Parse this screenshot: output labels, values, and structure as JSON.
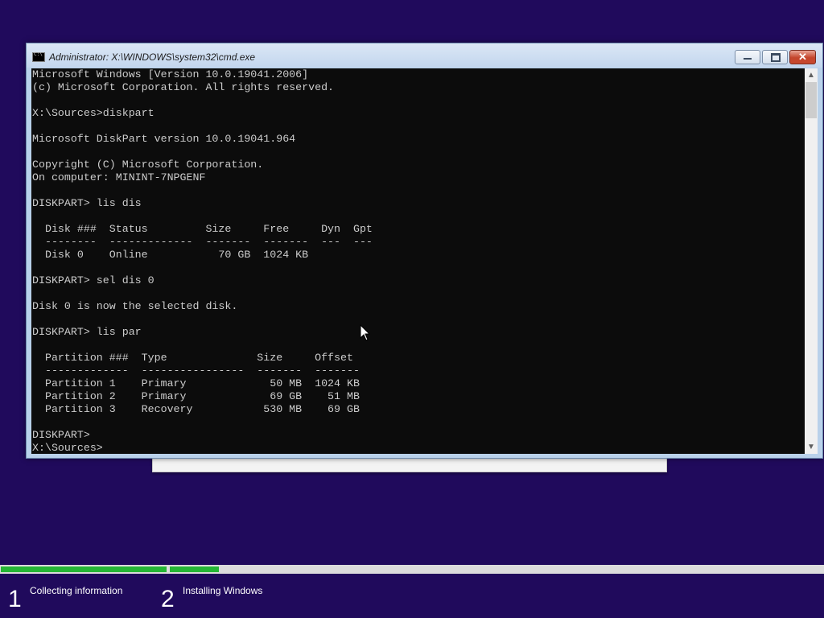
{
  "window": {
    "title": "Administrator: X:\\WINDOWS\\system32\\cmd.exe",
    "close_glyph": "✕"
  },
  "console": {
    "lines": [
      "Microsoft Windows [Version 10.0.19041.2006]",
      "(c) Microsoft Corporation. All rights reserved.",
      "",
      "X:\\Sources>diskpart",
      "",
      "Microsoft DiskPart version 10.0.19041.964",
      "",
      "Copyright (C) Microsoft Corporation.",
      "On computer: MININT-7NPGENF",
      "",
      "DISKPART> lis dis",
      "",
      "  Disk ###  Status         Size     Free     Dyn  Gpt",
      "  --------  -------------  -------  -------  ---  ---",
      "  Disk 0    Online           70 GB  1024 KB",
      "",
      "DISKPART> sel dis 0",
      "",
      "Disk 0 is now the selected disk.",
      "",
      "DISKPART> lis par",
      "",
      "  Partition ###  Type              Size     Offset",
      "  -------------  ----------------  -------  -------",
      "  Partition 1    Primary             50 MB  1024 KB",
      "  Partition 2    Primary             69 GB    51 MB",
      "  Partition 3    Recovery           530 MB    69 GB",
      "",
      "DISKPART>",
      "X:\\Sources>"
    ]
  },
  "setup": {
    "progress": {
      "step1_fraction": 1.0,
      "step2_fraction": 0.075
    },
    "steps": [
      {
        "number": "1",
        "label": "Collecting information"
      },
      {
        "number": "2",
        "label": "Installing Windows"
      }
    ]
  },
  "colors": {
    "background": "#200a5c",
    "progress_fill": "#25b635",
    "console_text": "#cccccc"
  }
}
